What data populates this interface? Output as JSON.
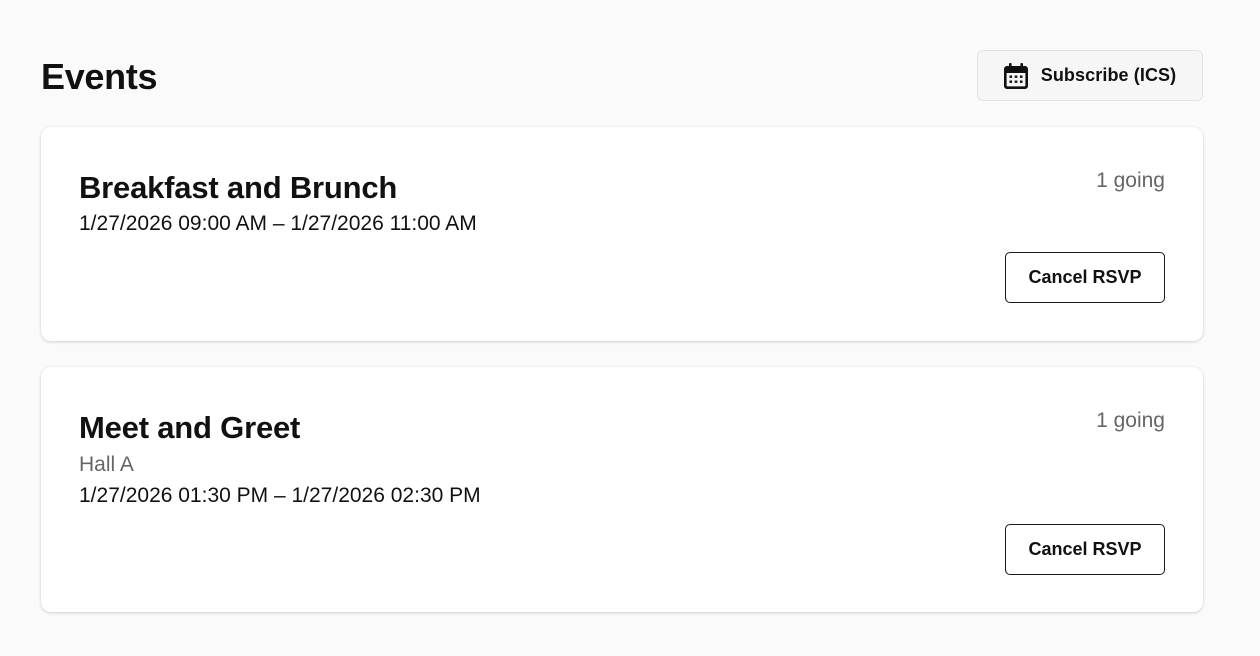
{
  "header": {
    "title": "Events",
    "subscribe": {
      "label": "Subscribe (ICS)",
      "icon": "calendar-icon"
    }
  },
  "events": [
    {
      "title": "Breakfast and Brunch",
      "location": "",
      "time": "1/27/2026 09:00 AM – 1/27/2026 11:00 AM",
      "going": "1 going",
      "action_label": "Cancel RSVP"
    },
    {
      "title": "Meet and Greet",
      "location": "Hall A",
      "time": "1/27/2026 01:30 PM – 1/27/2026 02:30 PM",
      "going": "1 going",
      "action_label": "Cancel RSVP"
    }
  ],
  "colors": {
    "background": "#fafafa",
    "card": "#ffffff",
    "text": "#111111",
    "muted": "#666666",
    "button_border": "#1a1a1a"
  }
}
